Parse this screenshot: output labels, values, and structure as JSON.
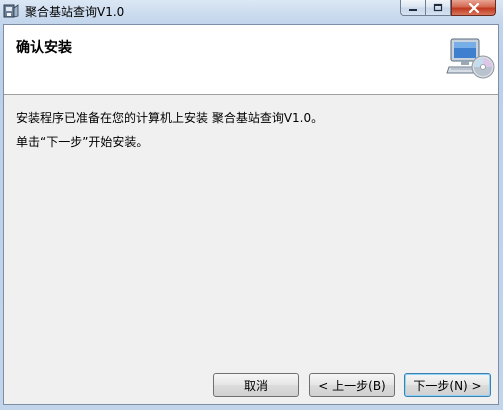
{
  "window": {
    "title": "聚合基站查询V1.0",
    "icon": "installer-app-icon"
  },
  "caption_buttons": {
    "minimize": "minimize-icon",
    "maximize": "maximize-icon",
    "close": "close-icon"
  },
  "header": {
    "title": "确认安装",
    "icon": "computer-cd-icon"
  },
  "body": {
    "line1": "安装程序已准备在您的计算机上安装 聚合基站查询V1.0。",
    "line2": "单击“下一步”开始安装。"
  },
  "buttons": {
    "cancel": "取消",
    "back": "< 上一步(B)",
    "next": "下一步(N) >"
  },
  "colors": {
    "title_bar": "#c3d6ec",
    "close_button": "#c0391f",
    "dialog_background": "#f0f0f0",
    "header_background": "#ffffff",
    "default_button_border": "#3c7fb1"
  }
}
